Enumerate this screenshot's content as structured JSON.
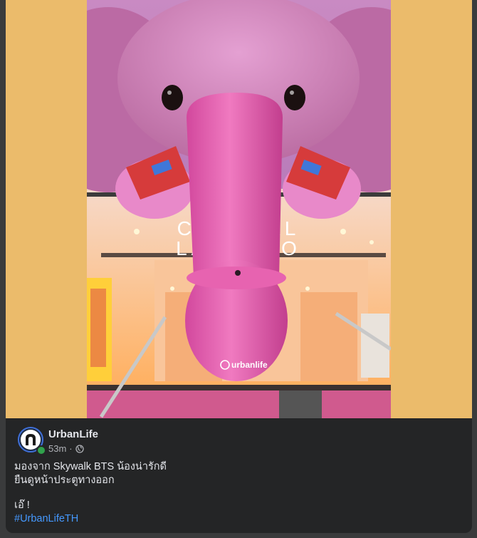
{
  "post": {
    "page_name": "UrbanLife",
    "time_ago": "53m",
    "separator": "·",
    "privacy_icon": "globe-icon",
    "caption_lines": [
      "มองจาก Skywalk BTS น้องน่ารักดี",
      "ยืนดูหน้าประตูทางออก",
      "เอ๊ !"
    ],
    "hashtag": "#UrbanLifeTH"
  },
  "photo": {
    "sign_line_1": "CENTRAL",
    "sign_line_2": "LADPRAO",
    "watermark": "urbanlife"
  },
  "colors": {
    "side_background": "#ebbb6b",
    "card": "#242526",
    "text_primary": "#e4e6eb",
    "text_secondary": "#b0b3b8",
    "hashtag": "#4599ff",
    "online": "#31a24c"
  }
}
